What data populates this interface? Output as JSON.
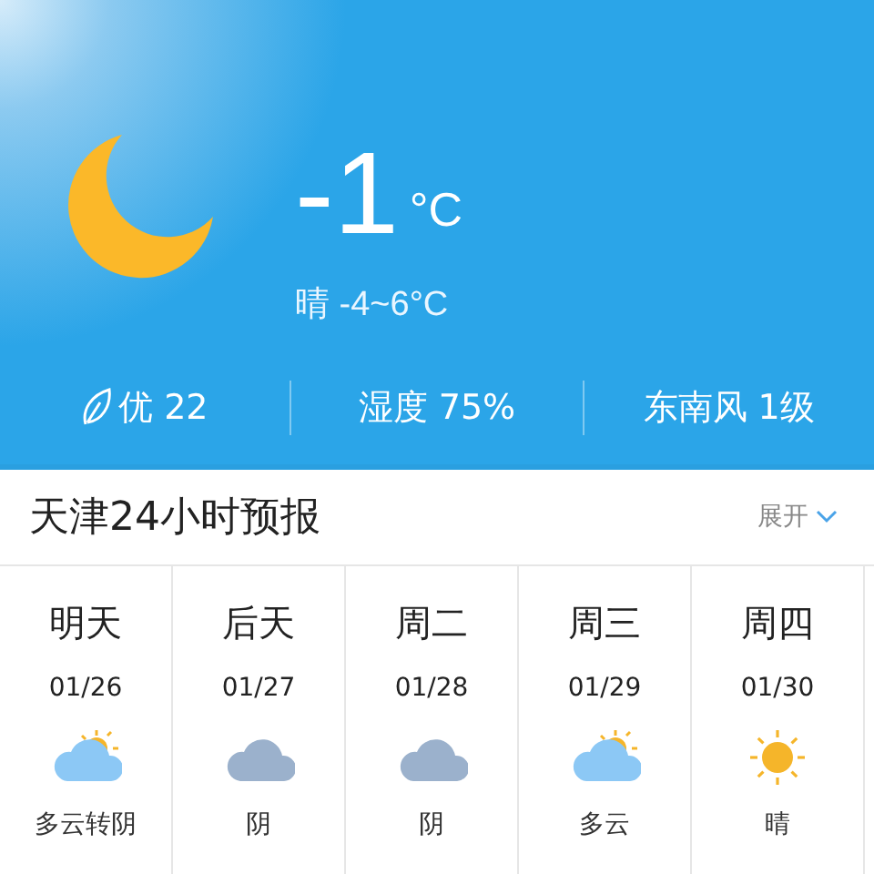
{
  "current": {
    "temperature": "-1",
    "unit": "°C",
    "summary": "晴 -4~6°C",
    "kind": "clear-night"
  },
  "stats": [
    {
      "kind": "aqi",
      "label": "优 22"
    },
    {
      "kind": "plain",
      "label": "湿度 75%"
    },
    {
      "kind": "plain",
      "label": "东南风 1级"
    }
  ],
  "forecast_header": {
    "title": "天津24小时预报",
    "toggle": "展开"
  },
  "days": [
    {
      "name": "明天",
      "date": "01/26",
      "kind": "partly-cloudy",
      "desc": "多云转阴"
    },
    {
      "name": "后天",
      "date": "01/27",
      "kind": "overcast",
      "desc": "阴"
    },
    {
      "name": "周二",
      "date": "01/28",
      "kind": "overcast",
      "desc": "阴"
    },
    {
      "name": "周三",
      "date": "01/29",
      "kind": "partly-cloudy",
      "desc": "多云"
    },
    {
      "name": "周四",
      "date": "01/30",
      "kind": "sunny",
      "desc": "晴"
    }
  ]
}
